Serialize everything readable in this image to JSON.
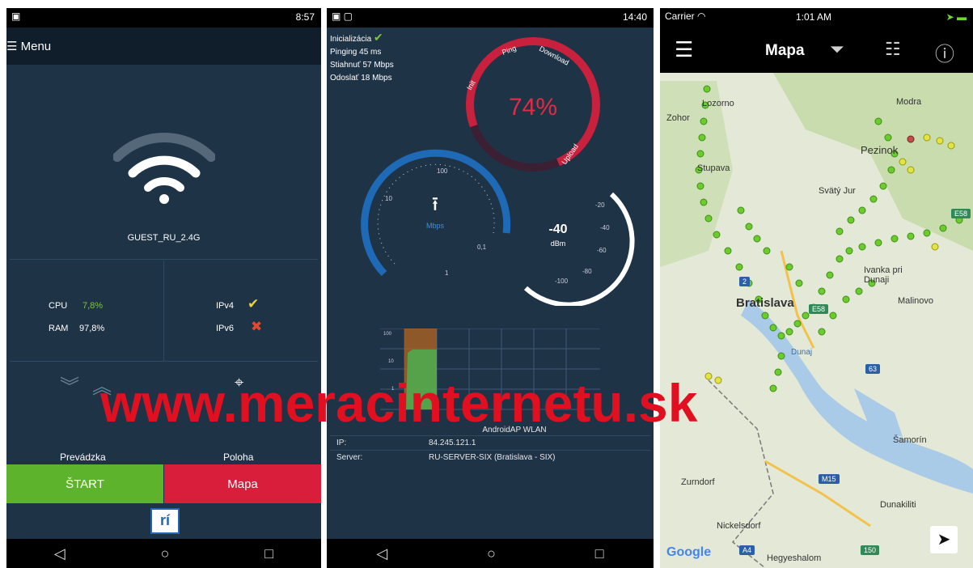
{
  "watermark": "www.meracinternetu.sk",
  "phone1": {
    "status_time": "8:57",
    "menu_label": "Menu",
    "ssid": "GUEST_RU_2.4G",
    "cpu_label": "CPU",
    "cpu_value": "7,8%",
    "ram_label": "RAM",
    "ram_value": "97,8%",
    "ipv4_label": "IPv4",
    "ipv6_label": "IPv6",
    "traffic_label": "Prevádzka",
    "location_label": "Poloha",
    "start_button": "ŠTART",
    "map_button": "Mapa",
    "colors": {
      "start": "#5db32c",
      "map": "#d81e3a"
    }
  },
  "phone2": {
    "status_time": "14:40",
    "stats": [
      "Inicializácia",
      "Pinging 45 ms",
      "Stiahnuť 57 Mbps",
      "Odoslať 18 Mbps"
    ],
    "gauge_labels": [
      "Init",
      "Ping",
      "Download",
      "Upload"
    ],
    "progress_percent": "74%",
    "progress": 0.74,
    "speed_unit": "Mbps",
    "speed_ticks": [
      "100",
      "10",
      "1",
      "0,1"
    ],
    "signal_value": "-40",
    "signal_unit": "dBm",
    "signal_ticks": [
      "-20",
      "-40",
      "-60",
      "-80",
      "-100"
    ],
    "graph_axis": [
      "100",
      "10",
      "1"
    ],
    "network_name": "AndroidAP WLAN",
    "ip_label": "IP:",
    "ip_value": "84.245.121.1",
    "server_label": "Server:",
    "server_value": "RU-SERVER-SIX (Bratislava - SIX)"
  },
  "phone3": {
    "carrier": "Carrier",
    "status_time": "1:01 AM",
    "title": "Mapa",
    "google": "Google",
    "places": [
      "Modra",
      "Lozorno",
      "Zohor",
      "Pezinok",
      "Stupava",
      "Svätý Jur",
      "Bratislava",
      "Ivanka pri Dunaji",
      "Malinovo",
      "Šamorín",
      "Zurndorf",
      "Dunakiliti",
      "Nickelsdorf",
      "Hegyeshalom",
      "Dunaj"
    ],
    "road_shields": [
      "E58",
      "2",
      "E58",
      "63",
      "M15",
      "A4",
      "150"
    ]
  }
}
